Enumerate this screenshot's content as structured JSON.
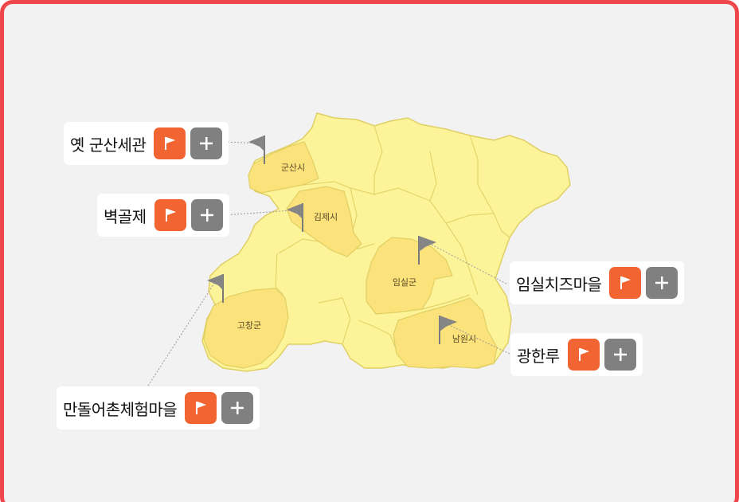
{
  "accent_color": "#f0474d",
  "regions": [
    {
      "id": "gunsan",
      "label": "군산시"
    },
    {
      "id": "gimje",
      "label": "김제시"
    },
    {
      "id": "imsil",
      "label": "임실군"
    },
    {
      "id": "gochang",
      "label": "고창군"
    },
    {
      "id": "namwon",
      "label": "남원시"
    }
  ],
  "places": [
    {
      "name": "옛 군산세관",
      "flag_icon": "flag-icon",
      "add_icon": "plus-icon"
    },
    {
      "name": "벽골제",
      "flag_icon": "flag-icon",
      "add_icon": "plus-icon"
    },
    {
      "name": "임실치즈마을",
      "flag_icon": "flag-icon",
      "add_icon": "plus-icon"
    },
    {
      "name": "광한루",
      "flag_icon": "flag-icon",
      "add_icon": "plus-icon"
    },
    {
      "name": "만돌어촌체험마을",
      "flag_icon": "flag-icon",
      "add_icon": "plus-icon"
    }
  ],
  "colors": {
    "flag_button": "#f26533",
    "add_button": "#808080",
    "map_fill": "#fdf49a",
    "map_highlight": "#fbe27a"
  }
}
